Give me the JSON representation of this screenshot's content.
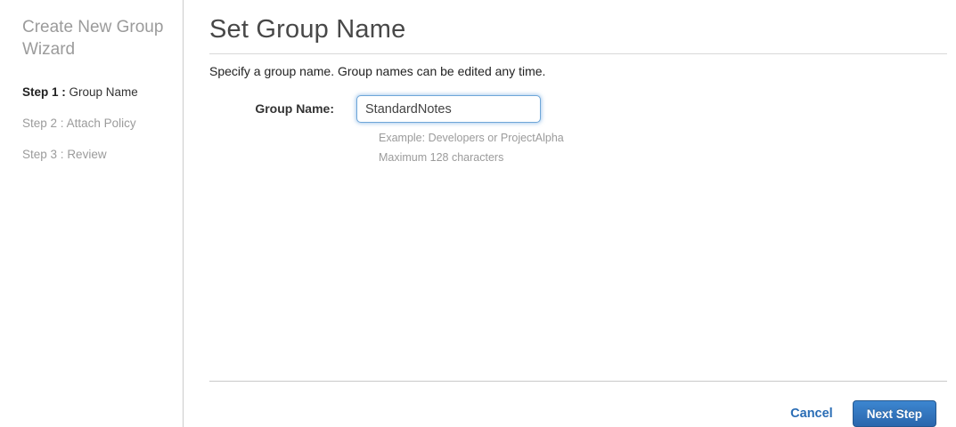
{
  "sidebar": {
    "title": "Create New Group Wizard",
    "steps": [
      {
        "prefix": "Step 1 :",
        "label": "Group Name",
        "active": true
      },
      {
        "prefix": "Step 2 :",
        "label": "Attach Policy",
        "active": false
      },
      {
        "prefix": "Step 3 :",
        "label": "Review",
        "active": false
      }
    ]
  },
  "main": {
    "title": "Set Group Name",
    "description": "Specify a group name. Group names can be edited any time.",
    "form": {
      "group_name_label": "Group Name:",
      "group_name_value": "StandardNotes",
      "hint_example": "Example: Developers or ProjectAlpha",
      "hint_max": "Maximum 128 characters"
    },
    "footer": {
      "cancel_label": "Cancel",
      "next_label": "Next Step"
    }
  },
  "colors": {
    "link_blue": "#2a6db5",
    "button_gradient_top": "#3c86d0",
    "button_gradient_bottom": "#2a66ad",
    "muted_text": "#9b9b9b",
    "heading_text": "#484848"
  }
}
